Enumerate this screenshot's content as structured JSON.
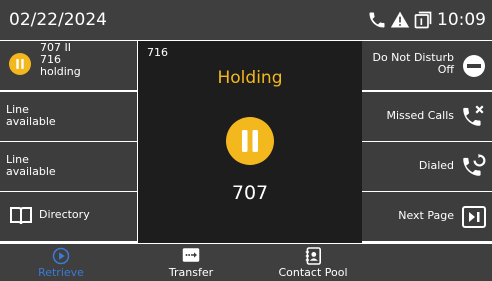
{
  "status_bar": {
    "date": "02/22/2024",
    "time": "10:09",
    "icons": [
      "phone-icon",
      "warning-icon",
      "call-park-icon"
    ]
  },
  "left_keys": [
    {
      "line1": "707 II",
      "line2": "716",
      "line3": "holding",
      "icon": "pause-icon"
    },
    {
      "line1": "Line",
      "line2": "available"
    },
    {
      "line1": "Line",
      "line2": "available"
    },
    {
      "label": "Directory",
      "icon": "book-icon"
    }
  ],
  "center": {
    "line_number": "716",
    "status": "Holding",
    "remote_number": "707",
    "status_color": "#f3b81d"
  },
  "right_keys": [
    {
      "line1": "Do Not Disturb",
      "line2": "Off",
      "icon": "dnd-icon"
    },
    {
      "label": "Missed Calls",
      "icon": "missed-call-icon"
    },
    {
      "label": "Dialed",
      "icon": "dialed-call-icon"
    },
    {
      "label": "Next Page",
      "icon": "next-page-icon"
    }
  ],
  "softkeys": [
    {
      "label": "Retrieve",
      "icon": "retrieve-icon",
      "color": "#3a7bd5"
    },
    {
      "label": "Transfer",
      "icon": "transfer-icon"
    },
    {
      "label": "Contact Pool",
      "icon": "contact-book-icon"
    }
  ]
}
